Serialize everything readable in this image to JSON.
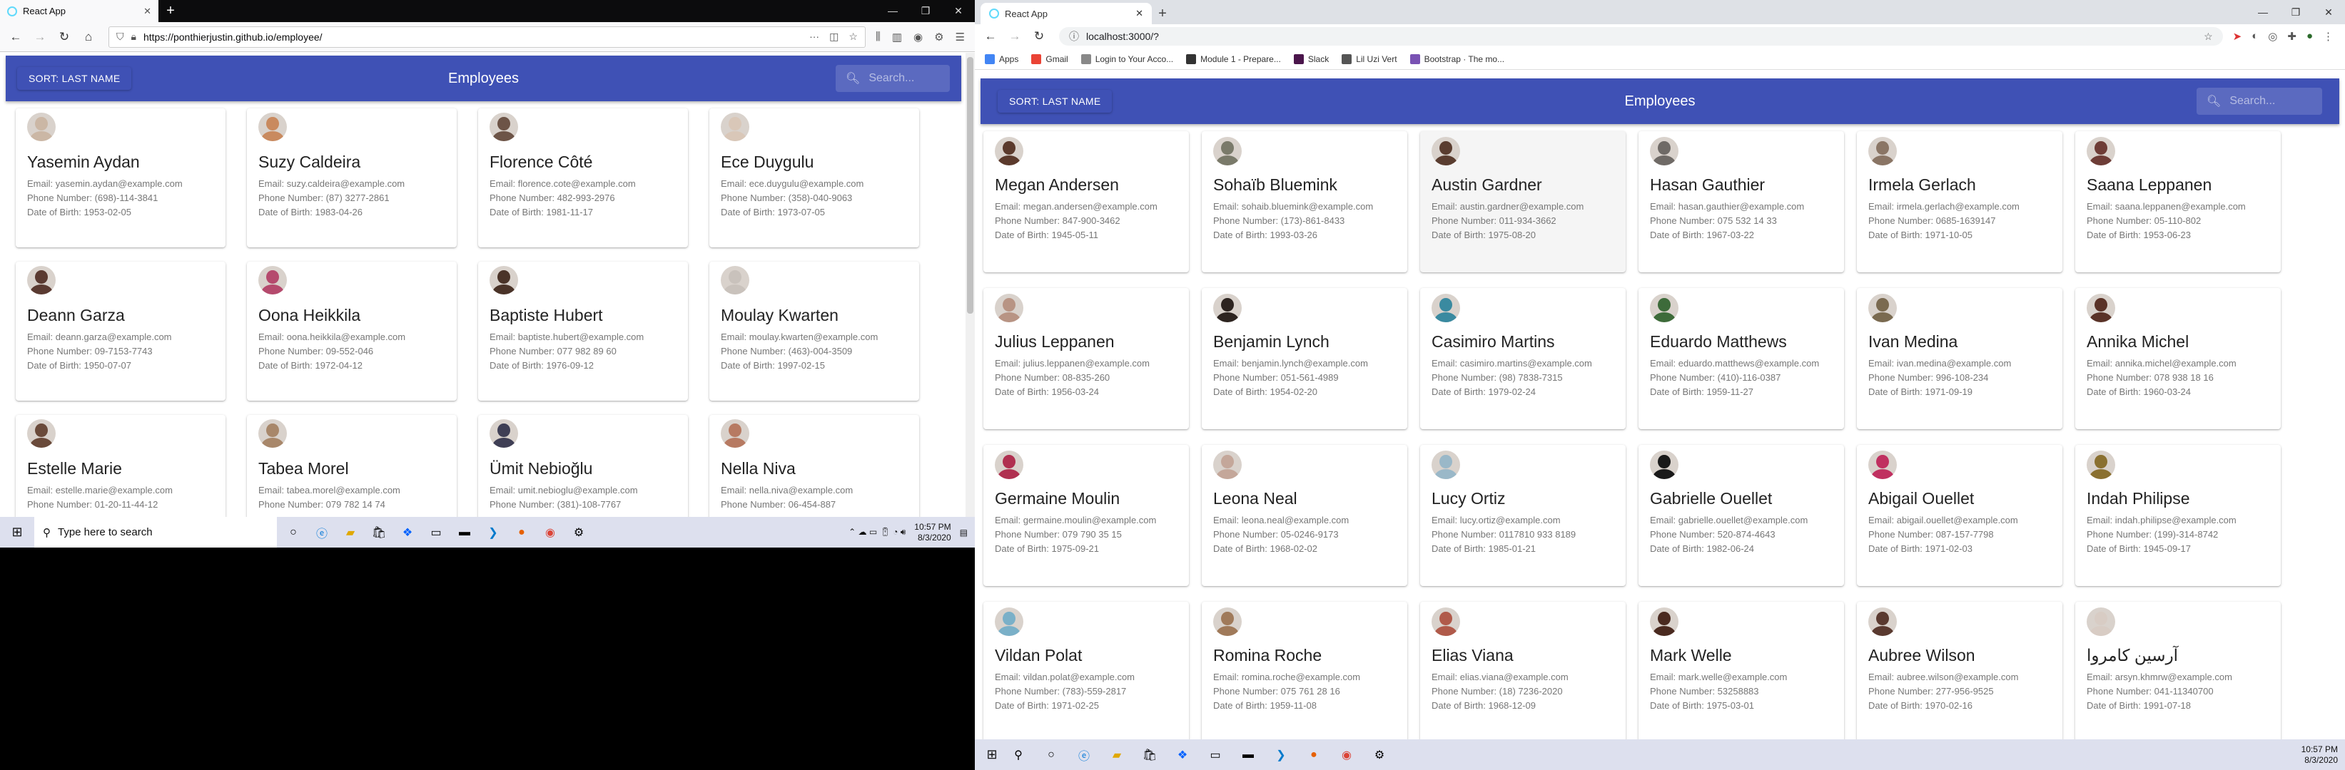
{
  "left": {
    "tab_title": "React App",
    "url": "https://ponthierjustin.github.io/employee/",
    "app": {
      "sort_label": "SORT: LAST NAME",
      "title": "Employees",
      "search_placeholder": "Search..."
    },
    "employees": [
      {
        "name": "Yasemin Aydan",
        "email": "Email: yasemin.aydan@example.com",
        "phone": "Phone Number: (698)-114-3841",
        "dob": "Date of Birth: 1953-02-05",
        "avatar_color": "#cbb7a5"
      },
      {
        "name": "Suzy Caldeira",
        "email": "Email: suzy.caldeira@example.com",
        "phone": "Phone Number: (87) 3277-2861",
        "dob": "Date of Birth: 1983-04-26",
        "avatar_color": "#c98a5f"
      },
      {
        "name": "Florence Côté",
        "email": "Email: florence.cote@example.com",
        "phone": "Phone Number: 482-993-2976",
        "dob": "Date of Birth: 1981-11-17",
        "avatar_color": "#6d5447"
      },
      {
        "name": "Ece Duygulu",
        "email": "Email: ece.duygulu@example.com",
        "phone": "Phone Number: (358)-040-9063",
        "dob": "Date of Birth: 1973-07-05",
        "avatar_color": "#d9c7b8"
      },
      {
        "name": "Deann Garza",
        "email": "Email: deann.garza@example.com",
        "phone": "Phone Number: 09-7153-7743",
        "dob": "Date of Birth: 1950-07-07",
        "avatar_color": "#5a3a31"
      },
      {
        "name": "Oona Heikkila",
        "email": "Email: oona.heikkila@example.com",
        "phone": "Phone Number: 09-552-046",
        "dob": "Date of Birth: 1972-04-12",
        "avatar_color": "#b54a6d"
      },
      {
        "name": "Baptiste Hubert",
        "email": "Email: baptiste.hubert@example.com",
        "phone": "Phone Number: 077 982 89 60",
        "dob": "Date of Birth: 1976-09-12",
        "avatar_color": "#4a3328"
      },
      {
        "name": "Moulay Kwarten",
        "email": "Email: moulay.kwarten@example.com",
        "phone": "Phone Number: (463)-004-3509",
        "dob": "Date of Birth: 1997-02-15",
        "avatar_color": "#c9c2bc"
      },
      {
        "name": "Estelle Marie",
        "email": "Email: estelle.marie@example.com",
        "phone": "Phone Number: 01-20-11-44-12",
        "dob": "",
        "avatar_color": "#6a4a3a"
      },
      {
        "name": "Tabea Morel",
        "email": "Email: tabea.morel@example.com",
        "phone": "Phone Number: 079 782 14 74",
        "dob": "",
        "avatar_color": "#a8876a"
      },
      {
        "name": "Ümit Nebioğlu",
        "email": "Email: umit.nebioglu@example.com",
        "phone": "Phone Number: (381)-108-7767",
        "dob": "",
        "avatar_color": "#3f3f55"
      },
      {
        "name": "Nella Niva",
        "email": "Email: nella.niva@example.com",
        "phone": "Phone Number: 06-454-887",
        "dob": "",
        "avatar_color": "#b77a62"
      }
    ],
    "taskbar": {
      "search_placeholder": "Type here to search",
      "time": "10:57 PM",
      "date": "8/3/2020"
    }
  },
  "right": {
    "tab_title": "React App",
    "url": "localhost:3000/?",
    "bookmarks": [
      {
        "label": "Apps",
        "color": "#4285f4"
      },
      {
        "label": "Gmail",
        "color": "#ea4335"
      },
      {
        "label": "Login to Your Acco...",
        "color": "#888888"
      },
      {
        "label": "Module 1 - Prepare...",
        "color": "#333333"
      },
      {
        "label": "Slack",
        "color": "#4a154b"
      },
      {
        "label": "Lil Uzi Vert",
        "color": "#555555"
      },
      {
        "label": "Bootstrap · The mo...",
        "color": "#7952b3"
      }
    ],
    "app": {
      "sort_label": "SORT: LAST NAME",
      "title": "Employees",
      "search_placeholder": "Search..."
    },
    "employees": [
      {
        "name": "Megan Andersen",
        "email": "Email: megan.andersen@example.com",
        "phone": "Phone Number: 847-900-3462",
        "dob": "Date of Birth: 1945-05-11",
        "avatar_color": "#5b3a2c"
      },
      {
        "name": "Sohaïb Bluemink",
        "email": "Email: sohaib.bluemink@example.com",
        "phone": "Phone Number: (173)-861-8433",
        "dob": "Date of Birth: 1993-03-26",
        "avatar_color": "#7a7a6a"
      },
      {
        "name": "Austin Gardner",
        "email": "Email: austin.gardner@example.com",
        "phone": "Phone Number: 011-934-3662",
        "dob": "Date of Birth: 1975-08-20",
        "avatar_color": "#5a3d30"
      },
      {
        "name": "Hasan Gauthier",
        "email": "Email: hasan.gauthier@example.com",
        "phone": "Phone Number: 075 532 14 33",
        "dob": "Date of Birth: 1967-03-22",
        "avatar_color": "#6f6a66"
      },
      {
        "name": "Irmela Gerlach",
        "email": "Email: irmela.gerlach@example.com",
        "phone": "Phone Number: 0685-1639147",
        "dob": "Date of Birth: 1971-10-05",
        "avatar_color": "#8a7565"
      },
      {
        "name": "Saana Leppanen",
        "email": "Email: saana.leppanen@example.com",
        "phone": "Phone Number: 05-110-802",
        "dob": "Date of Birth: 1953-06-23",
        "avatar_color": "#6e3d37"
      },
      {
        "name": "Julius Leppanen",
        "email": "Email: julius.leppanen@example.com",
        "phone": "Phone Number: 08-835-260",
        "dob": "Date of Birth: 1956-03-24",
        "avatar_color": "#b89484"
      },
      {
        "name": "Benjamin Lynch",
        "email": "Email: benjamin.lynch@example.com",
        "phone": "Phone Number: 051-561-4989",
        "dob": "Date of Birth: 1954-02-20",
        "avatar_color": "#2d2420"
      },
      {
        "name": "Casimiro Martins",
        "email": "Email: casimiro.martins@example.com",
        "phone": "Phone Number: (98) 7838-7315",
        "dob": "Date of Birth: 1979-02-24",
        "avatar_color": "#3a8aa0"
      },
      {
        "name": "Eduardo Matthews",
        "email": "Email: eduardo.matthews@example.com",
        "phone": "Phone Number: (410)-116-0387",
        "dob": "Date of Birth: 1959-11-27",
        "avatar_color": "#3d6b3a"
      },
      {
        "name": "Ivan Medina",
        "email": "Email: ivan.medina@example.com",
        "phone": "Phone Number: 996-108-234",
        "dob": "Date of Birth: 1971-09-19",
        "avatar_color": "#7a6a50"
      },
      {
        "name": "Annika Michel",
        "email": "Email: annika.michel@example.com",
        "phone": "Phone Number: 078 938 18 16",
        "dob": "Date of Birth: 1960-03-24",
        "avatar_color": "#5a3328"
      },
      {
        "name": "Germaine Moulin",
        "email": "Email: germaine.moulin@example.com",
        "phone": "Phone Number: 079 790 35 15",
        "dob": "Date of Birth: 1975-09-21",
        "avatar_color": "#b03050"
      },
      {
        "name": "Leona Neal",
        "email": "Email: leona.neal@example.com",
        "phone": "Phone Number: 05-0246-9173",
        "dob": "Date of Birth: 1968-02-02",
        "avatar_color": "#c4a79a"
      },
      {
        "name": "Lucy Ortiz",
        "email": "Email: lucy.ortiz@example.com",
        "phone": "Phone Number: 0117810 933 8189",
        "dob": "Date of Birth: 1985-01-21",
        "avatar_color": "#9ab8c8"
      },
      {
        "name": "Gabrielle Ouellet",
        "email": "Email: gabrielle.ouellet@example.com",
        "phone": "Phone Number: 520-874-4643",
        "dob": "Date of Birth: 1982-06-24",
        "avatar_color": "#1a1a1a"
      },
      {
        "name": "Abigail Ouellet",
        "email": "Email: abigail.ouellet@example.com",
        "phone": "Phone Number: 087-157-7798",
        "dob": "Date of Birth: 1971-02-03",
        "avatar_color": "#c03060"
      },
      {
        "name": "Indah Philipse",
        "email": "Email: indah.philipse@example.com",
        "phone": "Phone Number: (199)-314-8742",
        "dob": "Date of Birth: 1945-09-17",
        "avatar_color": "#8a7030"
      },
      {
        "name": "Vildan Polat",
        "email": "Email: vildan.polat@example.com",
        "phone": "Phone Number: (783)-559-2817",
        "dob": "Date of Birth: 1971-02-25",
        "avatar_color": "#7ab0c8"
      },
      {
        "name": "Romina Roche",
        "email": "Email: romina.roche@example.com",
        "phone": "Phone Number: 075 761 28 16",
        "dob": "Date of Birth: 1959-11-08",
        "avatar_color": "#a07a5a"
      },
      {
        "name": "Elias Viana",
        "email": "Email: elias.viana@example.com",
        "phone": "Phone Number: (18) 7236-2020",
        "dob": "Date of Birth: 1968-12-09",
        "avatar_color": "#b05a4a"
      },
      {
        "name": "Mark Welle",
        "email": "Email: mark.welle@example.com",
        "phone": "Phone Number: 53258883",
        "dob": "Date of Birth: 1975-03-01",
        "avatar_color": "#4a2a20"
      },
      {
        "name": "Aubree Wilson",
        "email": "Email: aubree.wilson@example.com",
        "phone": "Phone Number: 277-956-9525",
        "dob": "Date of Birth: 1970-02-16",
        "avatar_color": "#5a3a30"
      },
      {
        "name": "آرسین کامروا",
        "email": "Email: arsyn.khmrw@example.com",
        "phone": "Phone Number: 041-11340700",
        "dob": "Date of Birth: 1991-07-18",
        "avatar_color": "#d8ccc4"
      }
    ],
    "highlighted_index": 2,
    "taskbar": {
      "time": "10:57 PM",
      "date": "8/3/2020"
    }
  },
  "colors": {
    "app_bar": "#3f51b5",
    "taskbar": "#dde0ee",
    "firefox_tabbar": "#0c0c0d",
    "chrome_tabbar": "#dee1e6"
  }
}
